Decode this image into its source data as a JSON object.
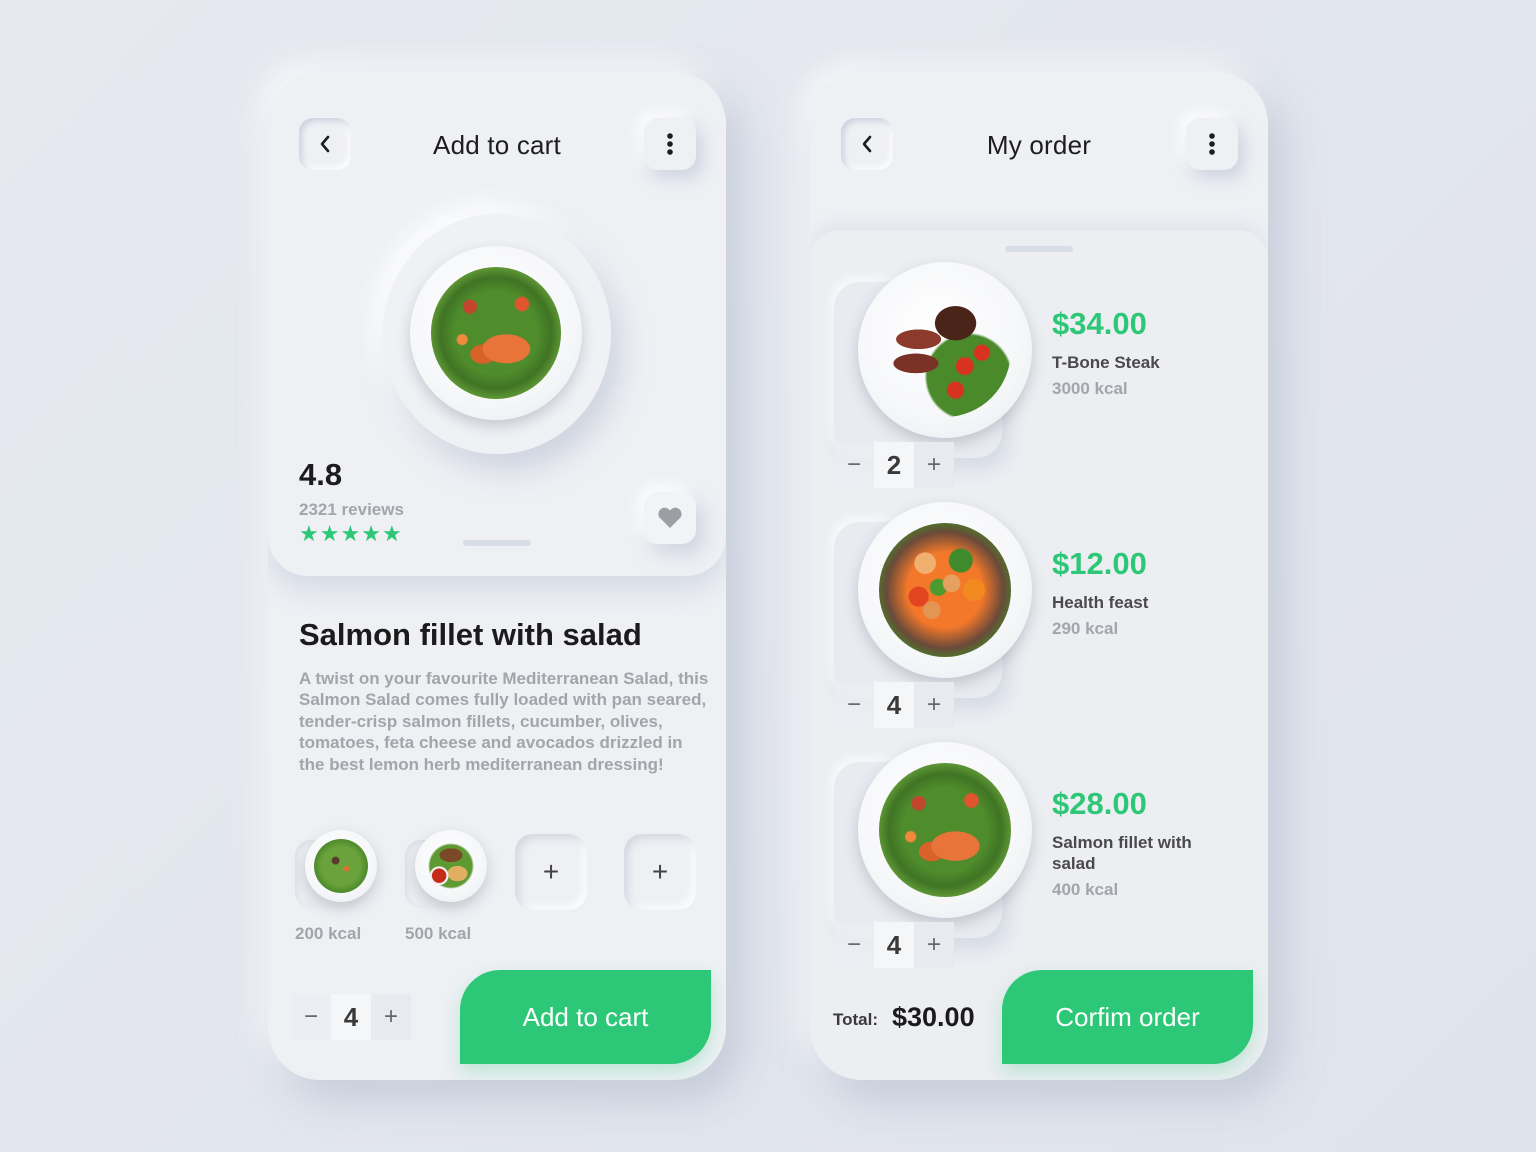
{
  "theme": {
    "accent": "#2cc878",
    "price_color": "#2dc777",
    "background": "#e3e6ed",
    "card": "#eef0f4"
  },
  "add_to_cart_screen": {
    "header": {
      "back_icon": "chevron-left-icon",
      "title": "Add to cart",
      "more_icon": "more-vertical-icon"
    },
    "hero_image": "salmon-salad-plate",
    "rating": {
      "value": "4.8",
      "reviews": "2321 reviews",
      "stars": 5,
      "stars_max": 5
    },
    "favorite_icon": "heart-icon",
    "dish": {
      "title": "Salmon fillet with salad",
      "description": "A twist on your favourite Mediterranean Salad, this Salmon Salad comes fully loaded with pan seared, tender-crisp salmon fillets, cucumber, olives, tomatoes, feta cheese and avocados drizzled in the best lemon herb mediterranean dressing!"
    },
    "addons": [
      {
        "image": "green-salad-plate",
        "kcal": "200 kcal"
      },
      {
        "image": "chicken-wings-plate",
        "kcal": "500 kcal"
      }
    ],
    "add_slots": [
      "+",
      "+"
    ],
    "quantity": {
      "minus": "−",
      "value": "4",
      "plus": "+"
    },
    "cta_label": "Add to cart"
  },
  "my_order_screen": {
    "header": {
      "back_icon": "chevron-left-icon",
      "title": "My order",
      "more_icon": "more-vertical-icon"
    },
    "items": [
      {
        "image": "t-bone-steak-plate",
        "price": "$34.00",
        "name": "T-Bone Steak",
        "kcal": "3000 kcal",
        "quantity": "2"
      },
      {
        "image": "health-feast-plate",
        "price": "$12.00",
        "name": "Health feast",
        "kcal": "290 kcal",
        "quantity": "4"
      },
      {
        "image": "salmon-salad-plate",
        "price": "$28.00",
        "name": "Salmon fillet with salad",
        "kcal": "400 kcal",
        "quantity": "4"
      }
    ],
    "stepper_symbols": {
      "minus": "−",
      "plus": "+"
    },
    "total_label": "Total:",
    "total_value": "$30.00",
    "cta_label": "Corfim order"
  }
}
